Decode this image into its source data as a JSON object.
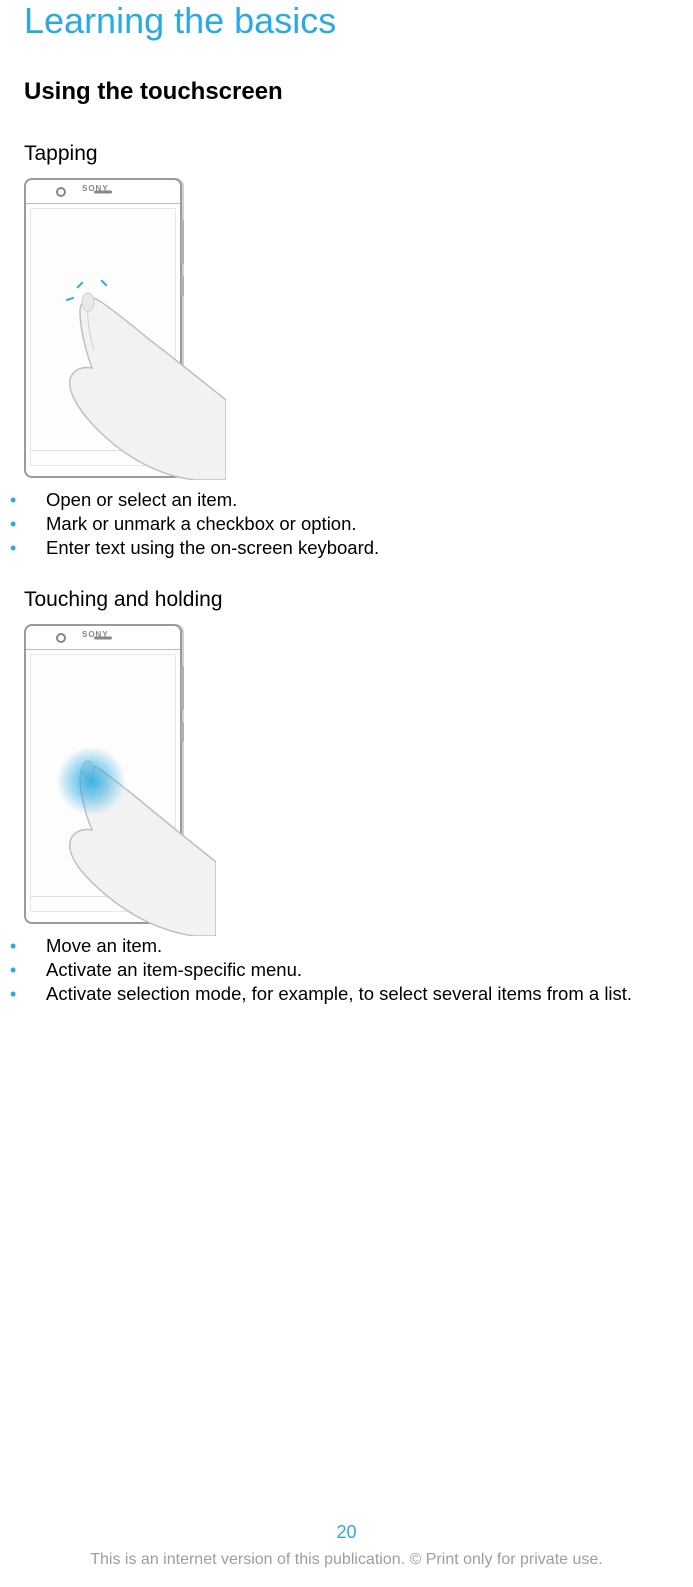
{
  "chapter_title": "Learning the basics",
  "section_title": "Using the touchscreen",
  "phone_brand": "SONY",
  "sections": [
    {
      "heading": "Tapping",
      "bullets": [
        "Open or select an item.",
        "Mark or unmark a checkbox or option.",
        "Enter text using the on-screen keyboard."
      ]
    },
    {
      "heading": "Touching and holding",
      "bullets": [
        "Move an item.",
        "Activate an item-specific menu.",
        "Activate selection mode, for example, to select several items from a list."
      ]
    }
  ],
  "page_number": "20",
  "copyright": "This is an internet version of this publication. © Print only for private use."
}
